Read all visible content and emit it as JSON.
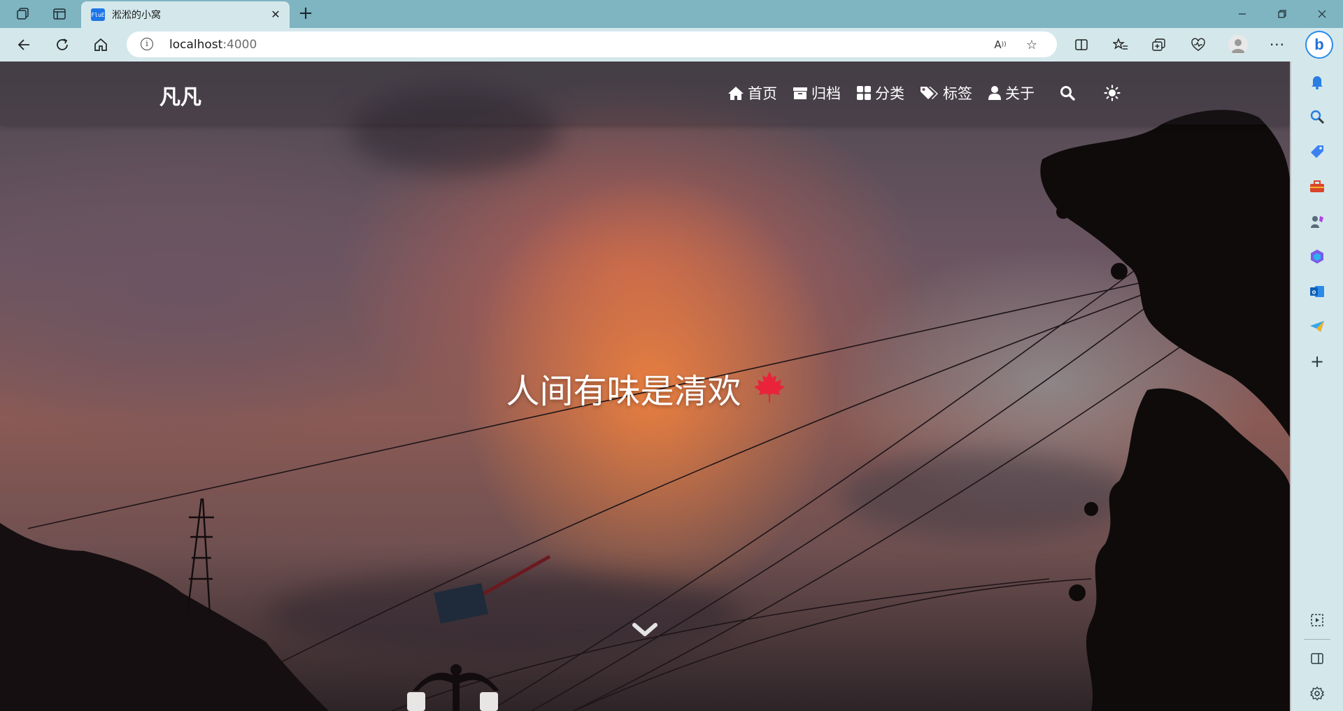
{
  "browser": {
    "tab": {
      "title": "淞淞的小窝",
      "favicon_text": "FluE"
    },
    "address": {
      "host": "localhost",
      "port": ":4000"
    },
    "accent": "#7fb4c1",
    "toolbar_icons": [
      "back-icon",
      "refresh-icon",
      "home-icon",
      "read-aloud-icon",
      "favorite-star-icon",
      "split-screen-icon",
      "favorites-icon",
      "collections-icon",
      "browser-essentials-icon",
      "profile-icon",
      "more-icon",
      "bing-copilot-icon"
    ],
    "bing_label": "b"
  },
  "sidebar": {
    "items": [
      "notifications-icon",
      "search-icon",
      "shopping-tag-icon",
      "tools-icon",
      "games-icon",
      "microsoft365-icon",
      "outlook-icon",
      "telegram-icon",
      "add-icon",
      "screenshot-icon",
      "sidebar-toggle-icon",
      "settings-icon"
    ],
    "outlook_letter": "o"
  },
  "page": {
    "brand": "凡凡",
    "nav": [
      {
        "label": "首页",
        "icon": "home-icon"
      },
      {
        "label": "归档",
        "icon": "archive-icon"
      },
      {
        "label": "分类",
        "icon": "categories-icon"
      },
      {
        "label": "标签",
        "icon": "tags-icon"
      },
      {
        "label": "关于",
        "icon": "user-icon"
      }
    ],
    "hero_title": "人间有味是清欢",
    "hero_emoji": "maple-leaf-icon",
    "leaf_color": "#e8233a"
  }
}
